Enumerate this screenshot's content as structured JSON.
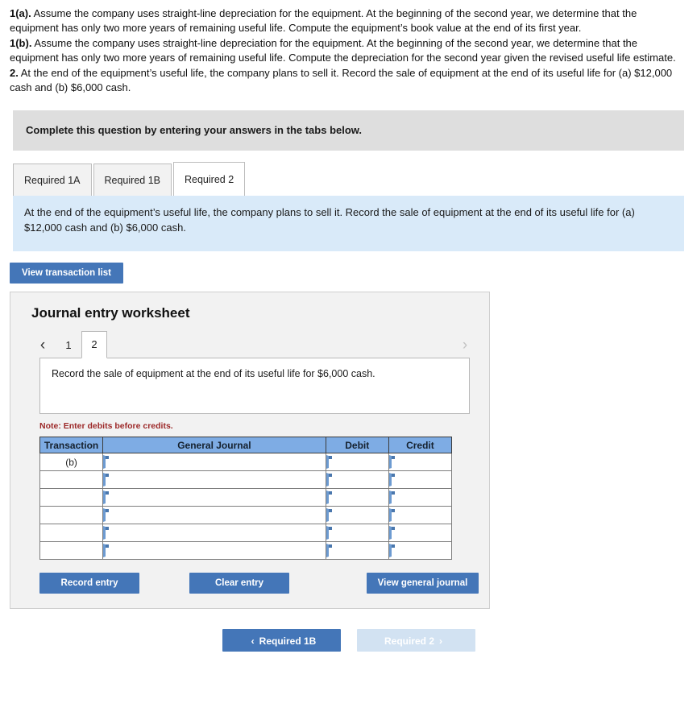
{
  "prompt": {
    "line1_label": "1(a).",
    "line1_text": " Assume the company uses straight-line depreciation for the equipment. At the beginning of the second year, we determine that the equipment has only two more years of remaining useful life. Compute the equipment’s book value at the end of its first year.",
    "line2_label": "1(b).",
    "line2_text": " Assume the company uses straight-line depreciation for the equipment. At the beginning of the second year, we determine that the equipment has only two more years of remaining useful life. Compute the depreciation for the second year given the revised useful life estimate.",
    "line3_label": "2.",
    "line3_text": " At the end of the equipment’s useful life, the company plans to sell it. Record the sale of equipment at the end of its useful life for (a) $12,000 cash and (b) $6,000 cash."
  },
  "gray_banner": {
    "text": "Complete this question by entering your answers in the tabs below."
  },
  "tabs": [
    {
      "label": "Required 1A",
      "active": false
    },
    {
      "label": "Required 1B",
      "active": false
    },
    {
      "label": "Required 2",
      "active": true
    }
  ],
  "blue_banner": {
    "text": "At the end of the equipment’s useful life, the company plans to sell it. Record the sale of equipment at the end of its useful life for (a) $12,000 cash and (b) $6,000 cash."
  },
  "view_transaction_list": {
    "label": "View transaction list"
  },
  "worksheet": {
    "title": "Journal entry worksheet",
    "prev_arrow": "‹",
    "next_arrow": "›",
    "pages": [
      {
        "label": "1",
        "active": false
      },
      {
        "label": "2",
        "active": true
      }
    ],
    "description": "Record the sale of equipment at the end of its useful life for $6,000 cash.",
    "note": "Note: Enter debits before credits."
  },
  "journal_table": {
    "headers": [
      "Transaction",
      "General Journal",
      "Debit",
      "Credit"
    ],
    "rows": [
      {
        "transaction": "(b)",
        "general_journal": "",
        "debit": "",
        "credit": ""
      },
      {
        "transaction": "",
        "general_journal": "",
        "debit": "",
        "credit": ""
      },
      {
        "transaction": "",
        "general_journal": "",
        "debit": "",
        "credit": ""
      },
      {
        "transaction": "",
        "general_journal": "",
        "debit": "",
        "credit": ""
      },
      {
        "transaction": "",
        "general_journal": "",
        "debit": "",
        "credit": ""
      },
      {
        "transaction": "",
        "general_journal": "",
        "debit": "",
        "credit": ""
      }
    ]
  },
  "worksheet_actions": {
    "record_entry": "Record entry",
    "clear_entry": "Clear entry",
    "view_general_journal": "View general journal"
  },
  "bottom_nav": {
    "prev_label": "Required 1B",
    "prev_chevron": "‹",
    "next_label": "Required 2",
    "next_chevron": "›"
  },
  "colors": {
    "primary_button": "#4476b8",
    "disabled_button": "#d2e2f2",
    "table_header": "#7eace4",
    "info_banner": "#d9eaf9",
    "gray_banner": "#dedede",
    "note_red": "#9c2828"
  }
}
